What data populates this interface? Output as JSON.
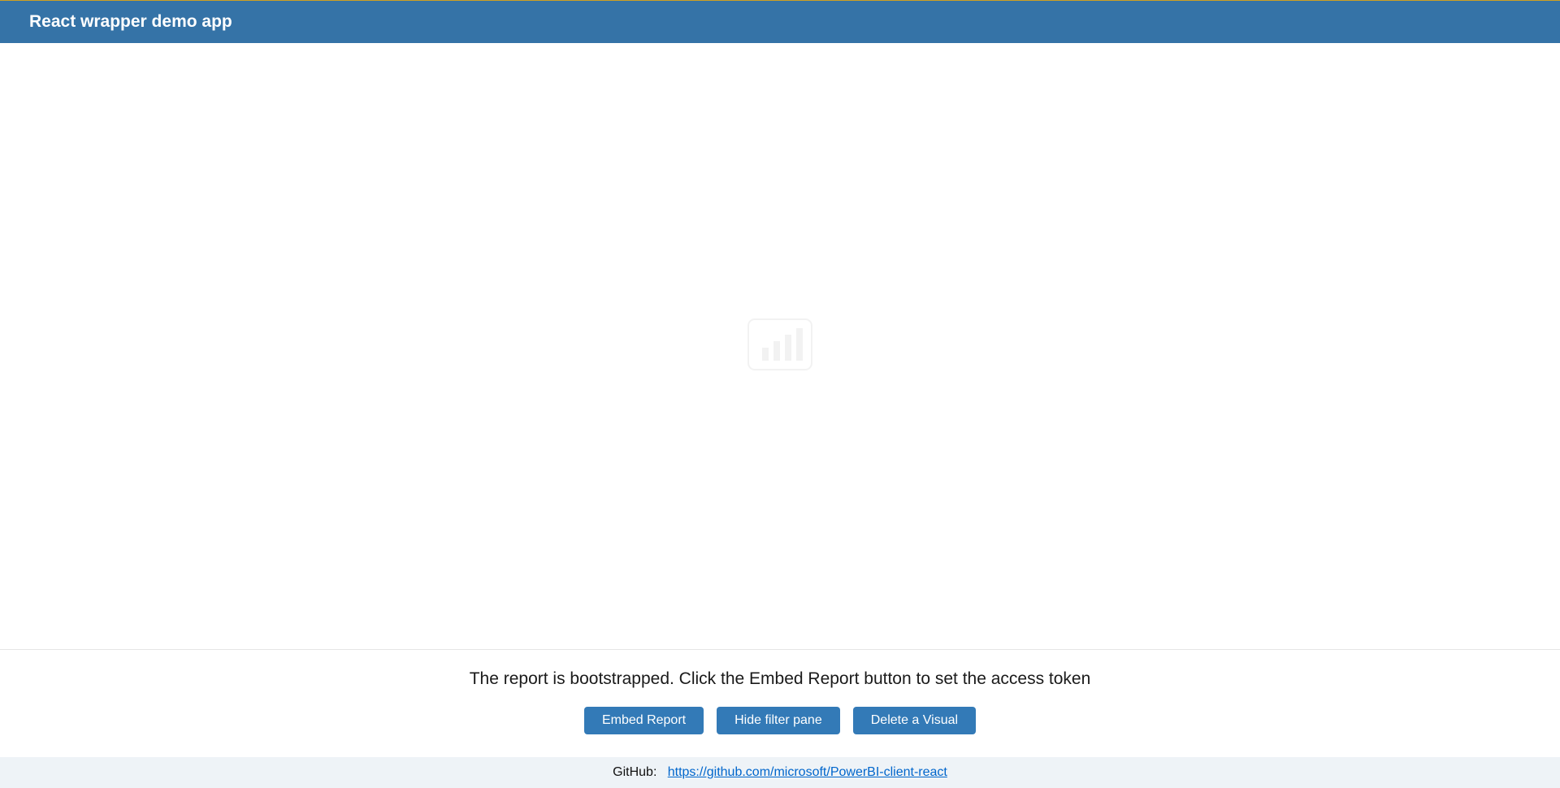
{
  "header": {
    "title": "React wrapper demo app"
  },
  "report": {
    "placeholder_icon": "powerbi-logo"
  },
  "controls": {
    "status_text": "The report is bootstrapped. Click the Embed Report button to set the access token",
    "buttons": {
      "embed": "Embed Report",
      "hide_filter": "Hide filter pane",
      "delete_visual": "Delete a Visual"
    }
  },
  "footer": {
    "label": "GitHub:",
    "link_text": "https://github.com/microsoft/PowerBI-client-react",
    "link_href": "https://github.com/microsoft/PowerBI-client-react"
  }
}
